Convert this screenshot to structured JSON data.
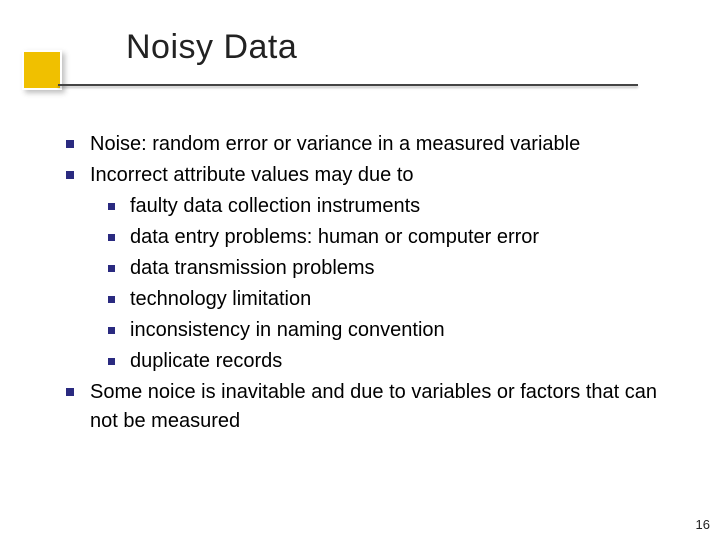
{
  "title": "Noisy Data",
  "bullets": {
    "b1": "Noise: random error or variance in a measured variable",
    "b2": "Incorrect attribute values may due to",
    "b2_1": "faulty data collection instruments",
    "b2_2": "data entry problems: human or computer error",
    "b2_3": "data transmission problems",
    "b2_4": "technology limitation",
    "b2_5": "inconsistency in naming convention",
    "b2_6": "duplicate records",
    "b3": "Some noice is inavitable and due to variables or factors that can not be measured"
  },
  "page_number": "16",
  "accent_color": "#f0c000"
}
